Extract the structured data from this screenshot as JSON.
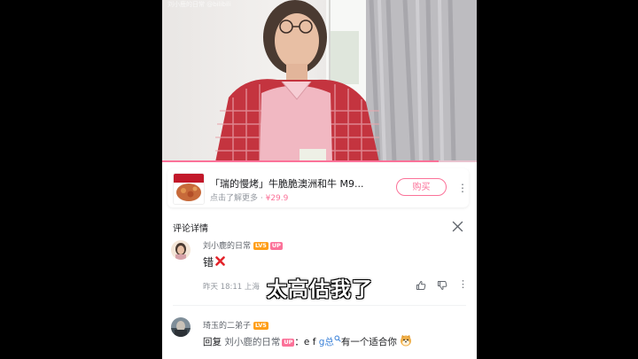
{
  "video": {
    "watermark": "刘小鹿的日常 @bilibili",
    "progress": 0.88
  },
  "product": {
    "title": "「瑞的慢烤」牛脆脆澳洲和牛 M9...",
    "sub_text": "点击了解更多 ·",
    "price": "¥29.9",
    "buy_label": "购买",
    "more_glyph": "⋮"
  },
  "comment_panel": {
    "title": "评论详情",
    "close_icon": "close-icon"
  },
  "comments": [
    {
      "username": "刘小鹿的日常",
      "level_badge": "LV5",
      "up_badge": "UP",
      "text": "错",
      "text_icon": "cross-icon",
      "meta": "昨天 18:11 上海",
      "more_glyph": "⋮"
    },
    {
      "username": "琦玉的二弟子",
      "level_badge": "LV5",
      "reply_prefix": "回复",
      "reply_to": "刘小鹿的日常",
      "reply_to_badge": "UP",
      "reply_colon": "：e f",
      "reply_link": "g总",
      "reply_suffix": "有一个适合你",
      "emoji_icon": "shiba-icon"
    }
  ],
  "overlay_caption": "太高估我了",
  "colors": {
    "accent": "#fb7299",
    "level_badge": "#ff9f1a",
    "link": "#3b82d8"
  }
}
